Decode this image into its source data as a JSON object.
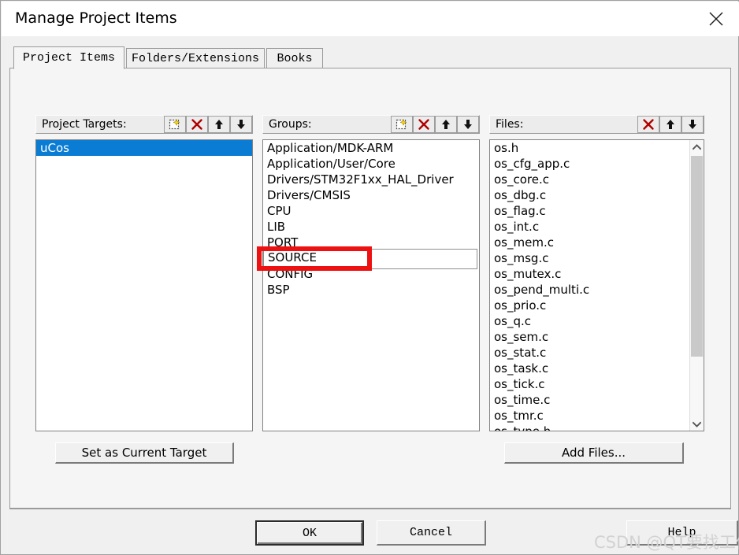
{
  "window": {
    "title": "Manage Project Items",
    "close_icon": "close-icon"
  },
  "tabs": [
    {
      "label": "Project Items",
      "active": true
    },
    {
      "label": "Folders/Extensions",
      "active": false
    },
    {
      "label": "Books",
      "active": false
    }
  ],
  "panels": {
    "targets": {
      "label": "Project Targets:",
      "buttons": [
        {
          "name": "new-item-button",
          "icon": "new-item-icon"
        },
        {
          "name": "delete-item-button",
          "icon": "red-x-icon"
        },
        {
          "name": "move-up-button",
          "icon": "arrow-up-icon"
        },
        {
          "name": "move-down-button",
          "icon": "arrow-down-icon"
        }
      ],
      "items": [
        {
          "label": "uCos",
          "selected": true
        }
      ],
      "action_button": "Set as Current Target"
    },
    "groups": {
      "label": "Groups:",
      "buttons": [
        {
          "name": "new-item-button",
          "icon": "new-item-icon"
        },
        {
          "name": "delete-item-button",
          "icon": "red-x-icon"
        },
        {
          "name": "move-up-button",
          "icon": "arrow-up-icon"
        },
        {
          "name": "move-down-button",
          "icon": "arrow-down-icon"
        }
      ],
      "items": [
        {
          "label": "Application/MDK-ARM"
        },
        {
          "label": "Application/User/Core"
        },
        {
          "label": "Drivers/STM32F1xx_HAL_Driver"
        },
        {
          "label": "Drivers/CMSIS"
        },
        {
          "label": "CPU"
        },
        {
          "label": "LIB"
        },
        {
          "label": "PORT"
        },
        {
          "label": "SOURCE"
        },
        {
          "label": "CONFIG"
        },
        {
          "label": "BSP"
        }
      ],
      "edit_value": "SOURCE"
    },
    "files": {
      "label": "Files:",
      "buttons": [
        {
          "name": "delete-item-button",
          "icon": "red-x-icon"
        },
        {
          "name": "move-up-button",
          "icon": "arrow-up-icon"
        },
        {
          "name": "move-down-button",
          "icon": "arrow-down-icon"
        }
      ],
      "items": [
        {
          "label": "os.h"
        },
        {
          "label": "os_cfg_app.c"
        },
        {
          "label": "os_core.c"
        },
        {
          "label": "os_dbg.c"
        },
        {
          "label": "os_flag.c"
        },
        {
          "label": "os_int.c"
        },
        {
          "label": "os_mem.c"
        },
        {
          "label": "os_msg.c"
        },
        {
          "label": "os_mutex.c"
        },
        {
          "label": "os_pend_multi.c"
        },
        {
          "label": "os_prio.c"
        },
        {
          "label": "os_q.c"
        },
        {
          "label": "os_sem.c"
        },
        {
          "label": "os_stat.c"
        },
        {
          "label": "os_task.c"
        },
        {
          "label": "os_tick.c"
        },
        {
          "label": "os_time.c"
        },
        {
          "label": "os_tmr.c"
        },
        {
          "label": "os_type.h"
        }
      ],
      "action_button": "Add Files..."
    }
  },
  "footer": {
    "ok_label": "OK",
    "cancel_label": "Cancel",
    "help_label": "Help"
  },
  "overlay": {
    "watermark": "CSDN @QT要找工作",
    "annotation_color": "#ee1111"
  }
}
